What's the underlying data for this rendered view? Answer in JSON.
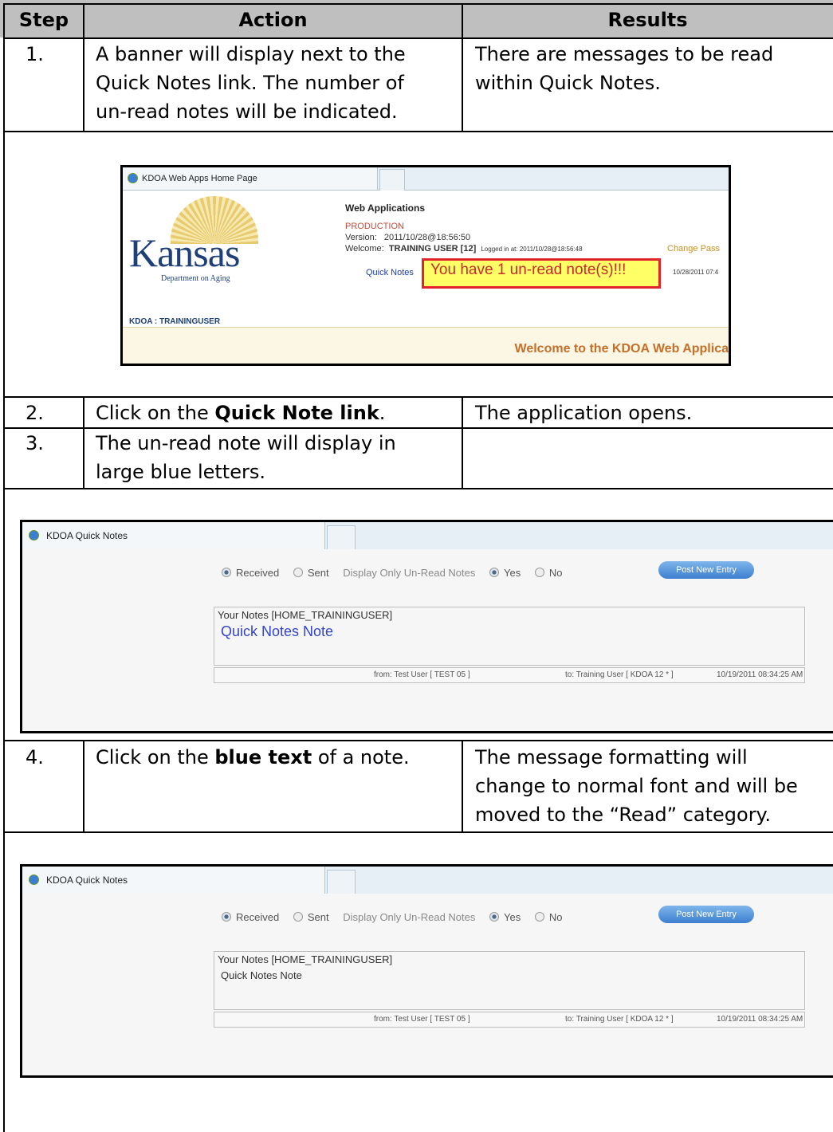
{
  "table": {
    "headers": {
      "step": "Step",
      "action": "Action",
      "results": "Results"
    },
    "rows": [
      {
        "step": "1.",
        "action_lines": [
          "A banner will display next to the",
          "Quick Notes link.  The number of",
          "un-read notes will be indicated."
        ],
        "result_lines": [
          "There are messages to be read",
          "within Quick Notes."
        ]
      },
      {
        "step": "2.",
        "action_pre": "Click on the ",
        "action_bold": "Quick Note link",
        "action_post": ".",
        "result_lines": [
          "The application opens."
        ]
      },
      {
        "step": "3.",
        "action_lines": [
          "The un-read note will display in",
          "large blue letters."
        ],
        "result_lines": []
      },
      {
        "step": "4.",
        "action_pre": "Click on the ",
        "action_bold": "blue text",
        "action_post": " of a note.",
        "result_lines": [
          "The message formatting will",
          "change to normal font and will be",
          "moved to the “Read” category."
        ]
      }
    ]
  },
  "shot1": {
    "tab_title": "KDOA Web Apps Home Page",
    "logo_text": "Kansas",
    "logo_subtext": "Department on Aging",
    "app_title": "Web Applications",
    "environment": "PRODUCTION",
    "version_label": "Version:",
    "version_value": "2011/10/28@18:56:50",
    "welcome_label": "Welcome:",
    "welcome_user": "TRAINING USER [12]",
    "logged_in": "Logged in at: 2011/10/28@18:56:48",
    "change_pass": "Change Pass",
    "quick_notes_link": "Quick Notes",
    "unread_banner": "You have 1 un-read note(s)!!!",
    "date_right": "10/28/2011 07:4",
    "user_line": "KDOA : TRAININGUSER",
    "welcome_banner": "Welcome to the KDOA Web Applica"
  },
  "quick_notes": {
    "tab_title": "KDOA Quick Notes",
    "received": "Received",
    "sent": "Sent",
    "display_only": "Display Only Un-Read Notes",
    "yes": "Yes",
    "no": "No",
    "post_button": "Post New Entry",
    "notes_header": "Your Notes [HOME_TRAININGUSER]",
    "note_title": "Quick Notes Note",
    "from": "from: Test User [ TEST 05 ]",
    "to": "to: Training User [ KDOA 12 * ]",
    "timestamp": "10/19/2011 08:34:25 AM"
  },
  "colors": {
    "header_bg": "#bfbfbf",
    "unread_blue": "#3344cc",
    "highlight_red": "#e0242a",
    "highlight_yellow": "#ffff66"
  }
}
